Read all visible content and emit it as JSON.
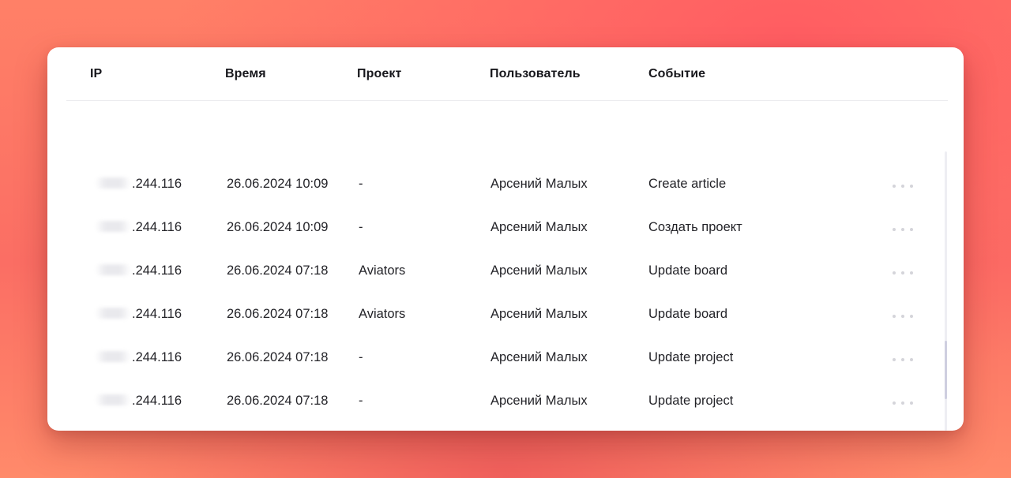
{
  "table": {
    "columns": {
      "ip": "IP",
      "time": "Время",
      "project": "Проект",
      "user": "Пользователь",
      "event": "Событие"
    },
    "rows": [
      {
        "ip_suffix": ".244.116",
        "time": "26.06.2024 10:09",
        "project": "-",
        "user": "Арсений Малых",
        "event": "Create article"
      },
      {
        "ip_suffix": ".244.116",
        "time": "26.06.2024 10:09",
        "project": "-",
        "user": "Арсений Малых",
        "event": "Создать проект"
      },
      {
        "ip_suffix": ".244.116",
        "time": "26.06.2024 07:18",
        "project": "Aviators",
        "user": "Арсений Малых",
        "event": "Update board"
      },
      {
        "ip_suffix": ".244.116",
        "time": "26.06.2024 07:18",
        "project": "Aviators",
        "user": "Арсений Малых",
        "event": "Update board"
      },
      {
        "ip_suffix": ".244.116",
        "time": "26.06.2024 07:18",
        "project": "-",
        "user": "Арсений Малых",
        "event": "Update project"
      },
      {
        "ip_suffix": ".244.116",
        "time": "26.06.2024 07:18",
        "project": "-",
        "user": "Арсений Малых",
        "event": "Update project"
      }
    ],
    "row_action_icon": "more-horizontal-icon"
  },
  "colors": {
    "background": "#ff7a66",
    "card": "#ffffff",
    "text": "#232328",
    "muted_dots": "#d4d4da"
  }
}
